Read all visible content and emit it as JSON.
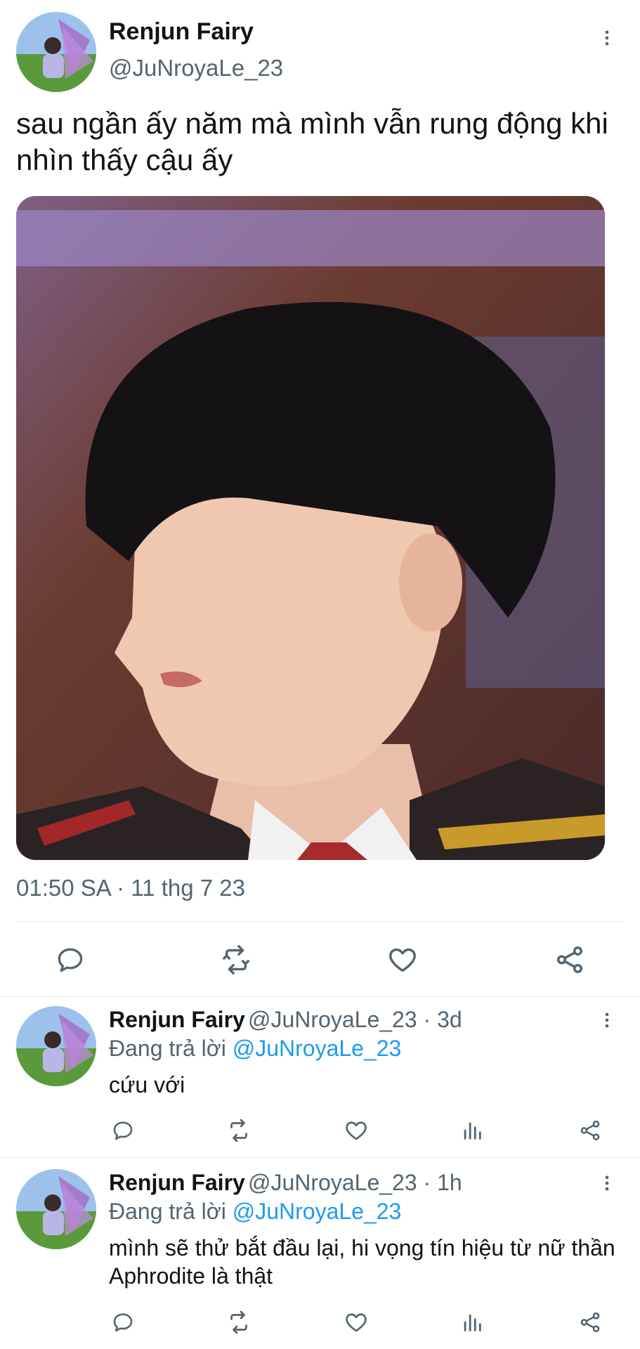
{
  "main_tweet": {
    "author_name": "Renjun Fairy",
    "author_handle": "@JuNroyaLe_23",
    "text": "sau ngần ấy năm mà mình vẫn rung động khi nhìn thấy cậu ấy",
    "timestamp": "01:50 SA · 11 thg 7 23",
    "more_icon": "more-vertical-icon",
    "actions": [
      "reply-icon",
      "retweet-icon",
      "like-icon",
      "share-icon"
    ]
  },
  "replies": [
    {
      "author_name": "Renjun Fairy",
      "author_handle": "@JuNroyaLe_23 · 3d",
      "replying_prefix": "Đang trả lời",
      "replying_to": "@JuNroyaLe_23",
      "text": "cứu với"
    },
    {
      "author_name": "Renjun Fairy",
      "author_handle": "@JuNroyaLe_23 · 1h",
      "replying_prefix": "Đang trả lời",
      "replying_to": "@JuNroyaLe_23",
      "text": "mình sẽ thử bắt đầu lại, hi vọng tín hiệu từ nữ thần Aphrodite là thật"
    }
  ],
  "colors": {
    "text": "#0f1419",
    "secondary": "#536471",
    "link": "#1d9bf0",
    "divider": "#e1e6ea"
  }
}
